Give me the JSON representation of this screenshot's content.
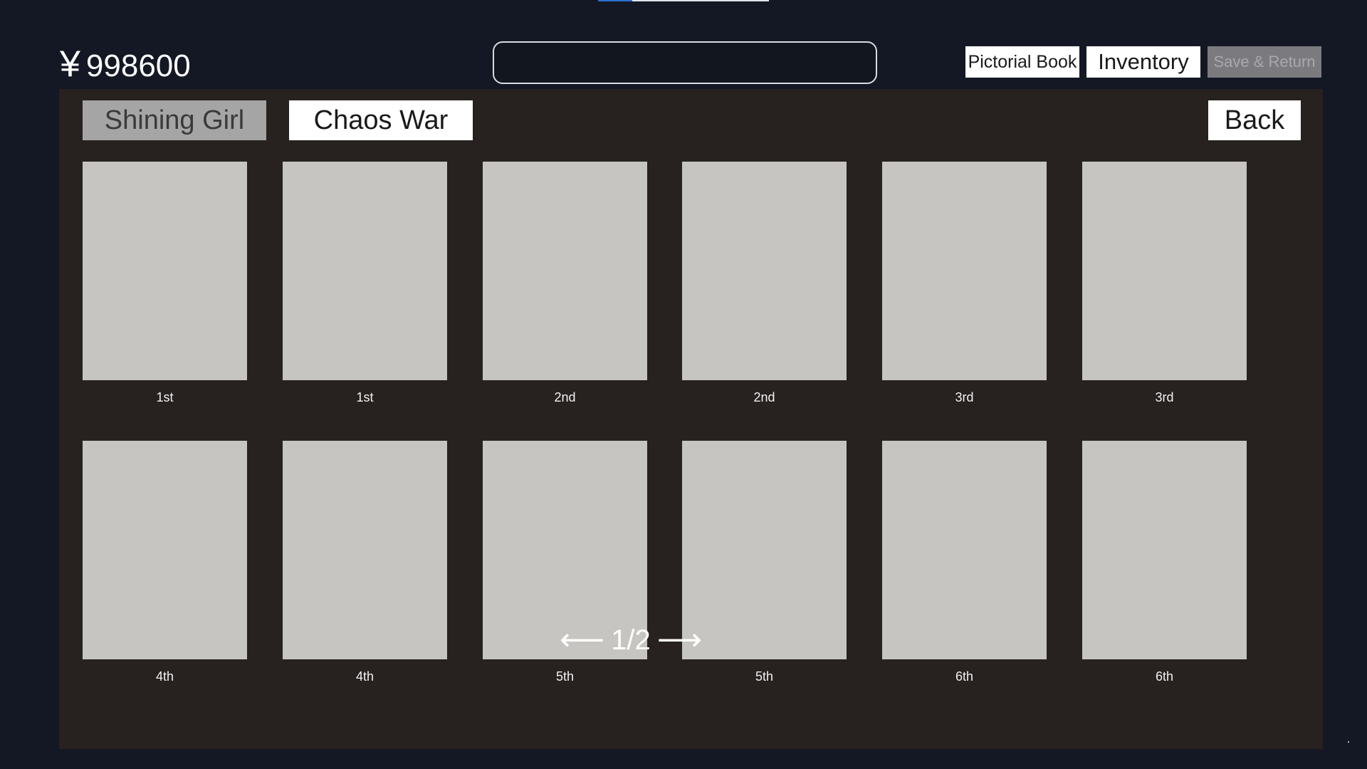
{
  "header": {
    "currency_symbol": "¥",
    "balance": "998600",
    "search": {
      "value": "",
      "placeholder": "",
      "icon": "search-icon"
    },
    "buttons": {
      "pictorial_book": "Pictorial Book",
      "inventory": "Inventory",
      "save_return": "Save & Return"
    }
  },
  "tabs": {
    "shining_girl": "Shining Girl",
    "chaos_war": "Chaos War",
    "selected": "Shining Girl"
  },
  "back_label": "Back",
  "cards": [
    {
      "label": "1st"
    },
    {
      "label": "1st"
    },
    {
      "label": "2nd"
    },
    {
      "label": "2nd"
    },
    {
      "label": "3rd"
    },
    {
      "label": "3rd"
    },
    {
      "label": "4th"
    },
    {
      "label": "4th"
    },
    {
      "label": "5th"
    },
    {
      "label": "5th"
    },
    {
      "label": "6th"
    },
    {
      "label": "6th"
    }
  ],
  "pagination": {
    "prev_arrow": "⟵",
    "page_text": "1/2",
    "next_arrow": "⟶"
  },
  "colors": {
    "background": "#141824",
    "panel": "#272120",
    "card_placeholder": "#c6c5c1",
    "selected_tab": "#a5a5a5",
    "disabled_button": "#7b7b7f"
  }
}
